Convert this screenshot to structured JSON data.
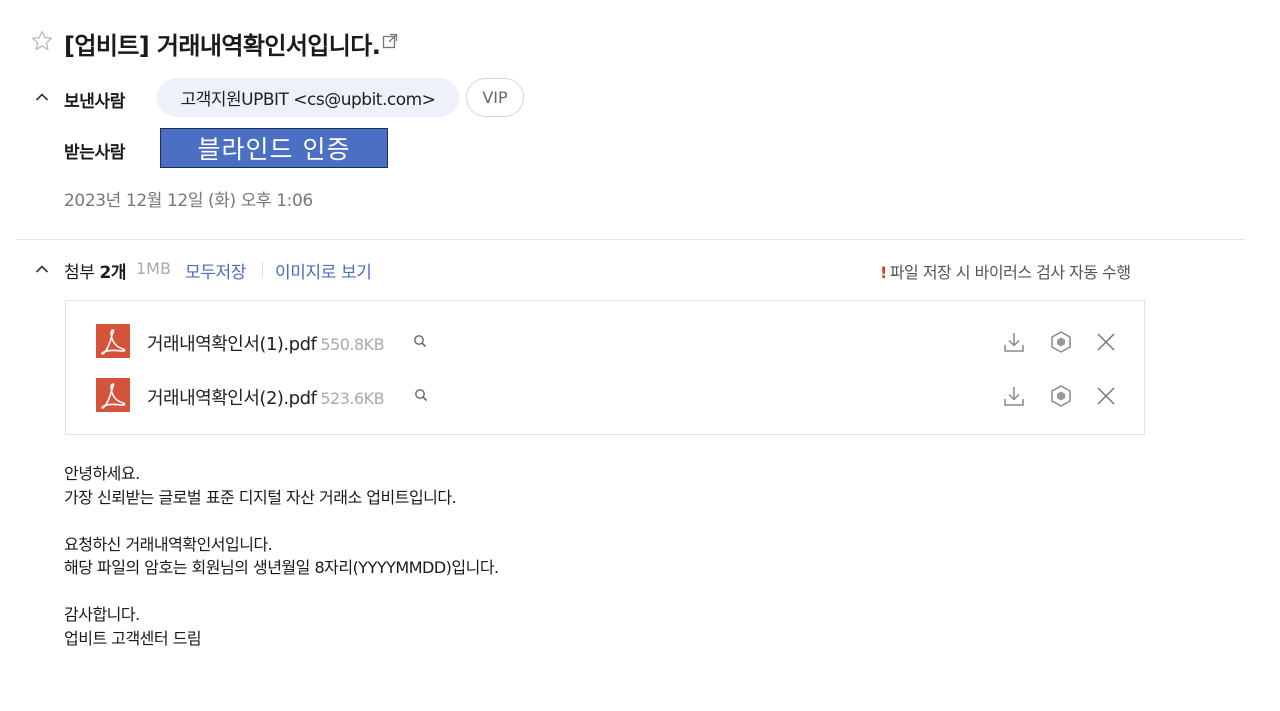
{
  "mail": {
    "subject": "[업비트] 거래내역확인서입니다.",
    "sender_label": "보낸사람",
    "sender": "고객지원UPBIT <cs@upbit.com>",
    "vip_label": "VIP",
    "recipient_label": "받는사람",
    "recipient_masked": "블라인드 인증",
    "date": "2023년 12월 12일 (화) 오후 1:06"
  },
  "attachments": {
    "label": "첨부",
    "count": "2개",
    "total_size": "1MB",
    "save_all": "모두저장",
    "view_as_image": "이미지로 보기",
    "virus_excl": "!",
    "virus_notice": "파일 저장 시 바이러스 검사 자동 수행",
    "files": [
      {
        "name": "거래내역확인서(1).pdf",
        "size": "550.8KB"
      },
      {
        "name": "거래내역확인서(2).pdf",
        "size": "523.6KB"
      }
    ]
  },
  "body": {
    "lines": [
      "안녕하세요.",
      "가장 신뢰받는 글로벌 표준 디지털 자산 거래소 업비트입니다.",
      "",
      "요청하신 거래내역확인서입니다.",
      "해당 파일의 암호는 회원님의 생년월일 8자리(YYYYMMDD)입니다.",
      "",
      "감사합니다.",
      "업비트 고객센터 드림"
    ]
  },
  "icons": {
    "star": "star-icon",
    "popout": "external-link-icon",
    "collapse": "chevron-up-icon",
    "pdf": "pdf-file-icon",
    "preview": "search-icon",
    "download": "download-icon",
    "cloud": "cube-icon",
    "remove": "close-icon"
  },
  "colors": {
    "accent_link": "#4b6cc0",
    "pdf_icon": "#d6533b",
    "warning": "#e03a2f",
    "blind_box": "#4b6fc2",
    "sender_chip": "#eef1fb"
  }
}
